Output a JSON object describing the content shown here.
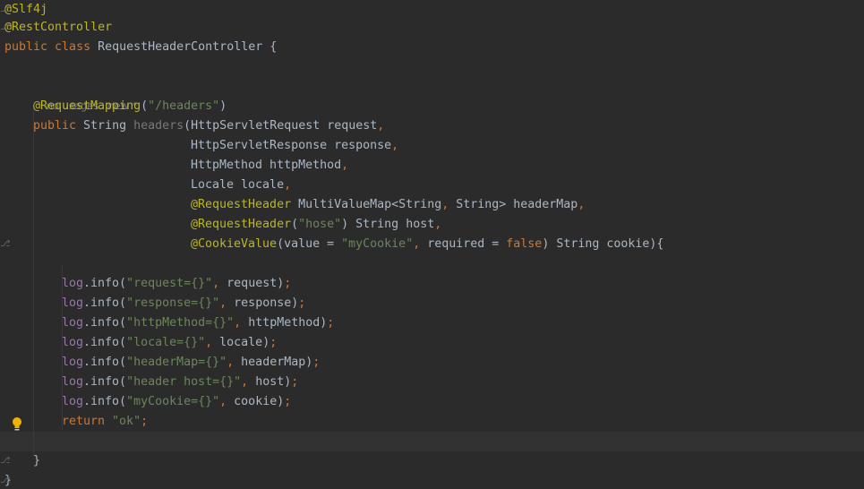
{
  "editor": {
    "inlay_hint": {
      "usages": "no usages",
      "author": "new *"
    },
    "icons": {
      "intention_bulb": "lightbulb-icon",
      "fold_marker": "fold-icon"
    },
    "colors": {
      "background": "#2b2b2b",
      "annotation": "#bbb529",
      "keyword": "#cc7832",
      "string": "#6a8759",
      "field": "#9876aa",
      "text": "#a9b7c6"
    },
    "lines": [
      {
        "tokens": [
          {
            "t": "@Slf4j",
            "c": "ann"
          }
        ]
      },
      {
        "tokens": [
          {
            "t": "@RestController",
            "c": "ann"
          }
        ]
      },
      {
        "tokens": [
          {
            "t": "public ",
            "c": "kw"
          },
          {
            "t": "class ",
            "c": "kw"
          },
          {
            "t": "RequestHeaderController ",
            "c": "plain"
          },
          {
            "t": "{",
            "c": "plain"
          }
        ]
      },
      {
        "tokens": []
      },
      {
        "tokens": [
          {
            "t": "@RequestMapping",
            "c": "ann"
          },
          {
            "t": "(",
            "c": "plain"
          },
          {
            "t": "\"/headers\"",
            "c": "str"
          },
          {
            "t": ")",
            "c": "plain"
          }
        ]
      },
      {
        "tokens": [
          {
            "t": "public ",
            "c": "kw"
          },
          {
            "t": "String ",
            "c": "plain"
          },
          {
            "t": "headers",
            "c": "fn-unused"
          },
          {
            "t": "(HttpServletRequest request",
            "c": "plain"
          },
          {
            "t": ",",
            "c": "kw"
          }
        ]
      },
      {
        "tokens": [
          {
            "t": "HttpServletResponse response",
            "c": "plain"
          },
          {
            "t": ",",
            "c": "kw"
          }
        ]
      },
      {
        "tokens": [
          {
            "t": "HttpMethod httpMethod",
            "c": "plain"
          },
          {
            "t": ",",
            "c": "kw"
          }
        ]
      },
      {
        "tokens": [
          {
            "t": "Locale locale",
            "c": "plain"
          },
          {
            "t": ",",
            "c": "kw"
          }
        ]
      },
      {
        "tokens": [
          {
            "t": "@RequestHeader ",
            "c": "ann"
          },
          {
            "t": "MultiValueMap<String",
            "c": "plain"
          },
          {
            "t": ", ",
            "c": "kw"
          },
          {
            "t": "String> headerMap",
            "c": "plain"
          },
          {
            "t": ",",
            "c": "kw"
          }
        ]
      },
      {
        "tokens": [
          {
            "t": "@RequestHeader",
            "c": "ann"
          },
          {
            "t": "(",
            "c": "plain"
          },
          {
            "t": "\"hose\"",
            "c": "str"
          },
          {
            "t": ") String host",
            "c": "plain"
          },
          {
            "t": ",",
            "c": "kw"
          }
        ]
      },
      {
        "tokens": [
          {
            "t": "@CookieValue",
            "c": "ann"
          },
          {
            "t": "(value = ",
            "c": "plain"
          },
          {
            "t": "\"myCookie\"",
            "c": "str"
          },
          {
            "t": ", ",
            "c": "kw"
          },
          {
            "t": "required = ",
            "c": "plain"
          },
          {
            "t": "false",
            "c": "kw"
          },
          {
            "t": ") String cookie){",
            "c": "plain"
          }
        ]
      },
      {
        "tokens": []
      },
      {
        "tokens": [
          {
            "t": "log",
            "c": "fld"
          },
          {
            "t": ".info(",
            "c": "plain"
          },
          {
            "t": "\"request={}\"",
            "c": "str"
          },
          {
            "t": ", ",
            "c": "kw"
          },
          {
            "t": "request)",
            "c": "plain"
          },
          {
            "t": ";",
            "c": "kw"
          }
        ]
      },
      {
        "tokens": [
          {
            "t": "log",
            "c": "fld"
          },
          {
            "t": ".info(",
            "c": "plain"
          },
          {
            "t": "\"response={}\"",
            "c": "str"
          },
          {
            "t": ", ",
            "c": "kw"
          },
          {
            "t": "response)",
            "c": "plain"
          },
          {
            "t": ";",
            "c": "kw"
          }
        ]
      },
      {
        "tokens": [
          {
            "t": "log",
            "c": "fld"
          },
          {
            "t": ".info(",
            "c": "plain"
          },
          {
            "t": "\"httpMethod={}\"",
            "c": "str"
          },
          {
            "t": ", ",
            "c": "kw"
          },
          {
            "t": "httpMethod)",
            "c": "plain"
          },
          {
            "t": ";",
            "c": "kw"
          }
        ]
      },
      {
        "tokens": [
          {
            "t": "log",
            "c": "fld"
          },
          {
            "t": ".info(",
            "c": "plain"
          },
          {
            "t": "\"locale={}\"",
            "c": "str"
          },
          {
            "t": ", ",
            "c": "kw"
          },
          {
            "t": "locale)",
            "c": "plain"
          },
          {
            "t": ";",
            "c": "kw"
          }
        ]
      },
      {
        "tokens": [
          {
            "t": "log",
            "c": "fld"
          },
          {
            "t": ".info(",
            "c": "plain"
          },
          {
            "t": "\"headerMap={}\"",
            "c": "str"
          },
          {
            "t": ", ",
            "c": "kw"
          },
          {
            "t": "headerMap)",
            "c": "plain"
          },
          {
            "t": ";",
            "c": "kw"
          }
        ]
      },
      {
        "tokens": [
          {
            "t": "log",
            "c": "fld"
          },
          {
            "t": ".info(",
            "c": "plain"
          },
          {
            "t": "\"header host={}\"",
            "c": "str"
          },
          {
            "t": ", ",
            "c": "kw"
          },
          {
            "t": "host)",
            "c": "plain"
          },
          {
            "t": ";",
            "c": "kw"
          }
        ]
      },
      {
        "tokens": [
          {
            "t": "log",
            "c": "fld"
          },
          {
            "t": ".info(",
            "c": "plain"
          },
          {
            "t": "\"myCookie={}\"",
            "c": "str"
          },
          {
            "t": ", ",
            "c": "kw"
          },
          {
            "t": "cookie)",
            "c": "plain"
          },
          {
            "t": ";",
            "c": "kw"
          }
        ]
      },
      {
        "tokens": [
          {
            "t": "return ",
            "c": "kw"
          },
          {
            "t": "\"ok\"",
            "c": "str"
          },
          {
            "t": ";",
            "c": "kw"
          }
        ]
      },
      {
        "tokens": []
      },
      {
        "tokens": [
          {
            "t": "}",
            "c": "plain"
          }
        ]
      },
      {
        "tokens": [
          {
            "t": "}",
            "c": "plain"
          }
        ]
      }
    ]
  }
}
